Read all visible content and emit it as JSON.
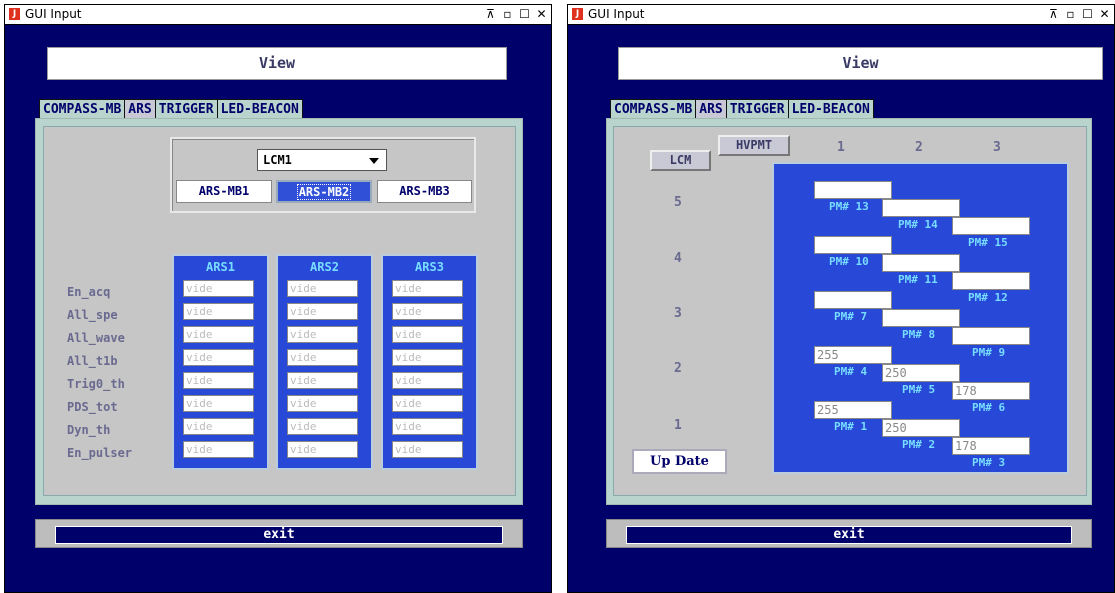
{
  "window_title": "GUI Input",
  "title_controls": [
    "⊼",
    "▫",
    "☐",
    "✕"
  ],
  "view_label": "View",
  "tabs": [
    "COMPASS-MB",
    "ARS",
    "TRIGGER",
    "LED-BEACON"
  ],
  "exit_label": "exit",
  "ars_window": {
    "active_tab": "ARS",
    "lcm_select": "LCM1",
    "mb_buttons": [
      "ARS-MB1",
      "ARS-MB2",
      "ARS-MB3"
    ],
    "selected_mb": "ARS-MB2",
    "columns": [
      "ARS1",
      "ARS2",
      "ARS3"
    ],
    "rows": [
      "En_acq",
      "All_spe",
      "All_wave",
      "All_t1b",
      "Trig0_th",
      "PDS_tot",
      "Dyn_th",
      "En_pulser"
    ],
    "placeholder": "vide"
  },
  "lcm_window": {
    "lcm_button": "LCM",
    "hvpmt_button": "HVPMT",
    "col_headers": [
      "1",
      "2",
      "3"
    ],
    "row_headers": [
      "5",
      "4",
      "3",
      "2",
      "1"
    ],
    "pms": [
      {
        "label": "PM# 13",
        "value": ""
      },
      {
        "label": "PM# 14",
        "value": ""
      },
      {
        "label": "PM# 15",
        "value": ""
      },
      {
        "label": "PM# 10",
        "value": ""
      },
      {
        "label": "PM# 11",
        "value": ""
      },
      {
        "label": "PM# 12",
        "value": ""
      },
      {
        "label": "PM# 7",
        "value": ""
      },
      {
        "label": "PM# 8",
        "value": ""
      },
      {
        "label": "PM# 9",
        "value": ""
      },
      {
        "label": "PM# 4",
        "value": "255"
      },
      {
        "label": "PM# 5",
        "value": "250"
      },
      {
        "label": "PM# 6",
        "value": "178"
      },
      {
        "label": "PM# 1",
        "value": "255"
      },
      {
        "label": "PM# 2",
        "value": "250"
      },
      {
        "label": "PM# 3",
        "value": "178"
      }
    ],
    "update_label": "Up Date"
  },
  "colors": {
    "window_bg": "#00006b",
    "panel_bg": "#b8d4cc",
    "blue_panel": "#2848d8",
    "label_cyan": "#77ddff"
  }
}
